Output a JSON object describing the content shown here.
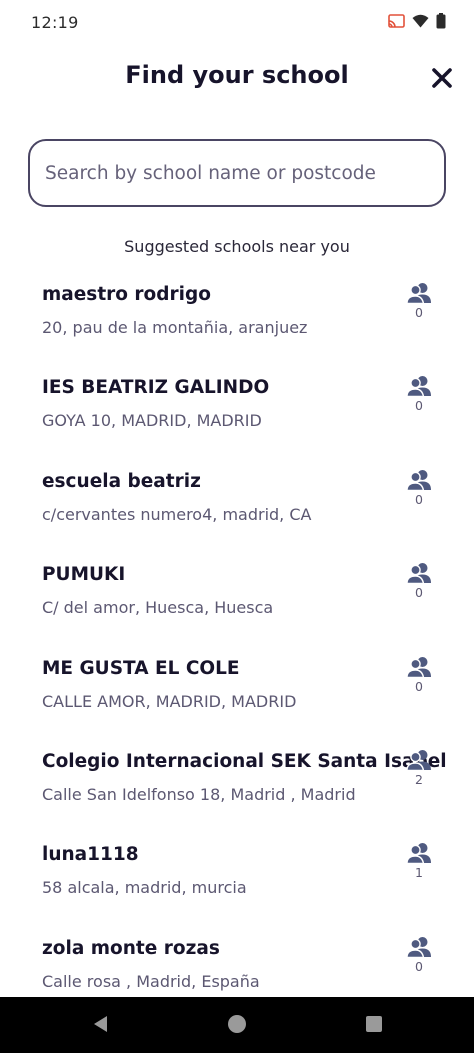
{
  "status": {
    "time": "12:19",
    "icons": [
      "cast-icon",
      "wifi-icon",
      "battery-icon"
    ]
  },
  "header": {
    "title": "Find your school",
    "close_icon": "close-icon"
  },
  "search": {
    "placeholder": "Search by school name or postcode",
    "value": ""
  },
  "suggested_label": "Suggested schools near you",
  "schools": [
    {
      "name": "maestro rodrigo",
      "address": "20, pau de la montañia, aranjuez",
      "members": "0"
    },
    {
      "name": "IES BEATRIZ GALINDO",
      "address": "GOYA 10, MADRID, MADRID",
      "members": "0"
    },
    {
      "name": "escuela beatriz",
      "address": "c/cervantes numero4, madrid, CA",
      "members": "0"
    },
    {
      "name": "PUMUKI",
      "address": "C/ del amor, Huesca, Huesca",
      "members": "0"
    },
    {
      "name": "ME GUSTA EL COLE",
      "address": "CALLE AMOR, MADRID, MADRID",
      "members": "0"
    },
    {
      "name": "Colegio Internacional SEK Santa Isabel",
      "address": "Calle San Idelfonso 18, Madrid , Madrid",
      "members": "2"
    },
    {
      "name": "luna1118",
      "address": "58 alcala, madrid, murcia",
      "members": "1"
    },
    {
      "name": "zola monte rozas",
      "address": "Calle rosa , Madrid, España",
      "members": "0"
    }
  ],
  "nav": {
    "back_icon": "back-triangle-icon",
    "home_icon": "home-circle-icon",
    "recents_icon": "recents-square-icon"
  },
  "colors": {
    "text_primary": "#17142b",
    "text_secondary": "#5c5872",
    "members_icon": "#4f5a80",
    "search_border": "#4a4563"
  }
}
